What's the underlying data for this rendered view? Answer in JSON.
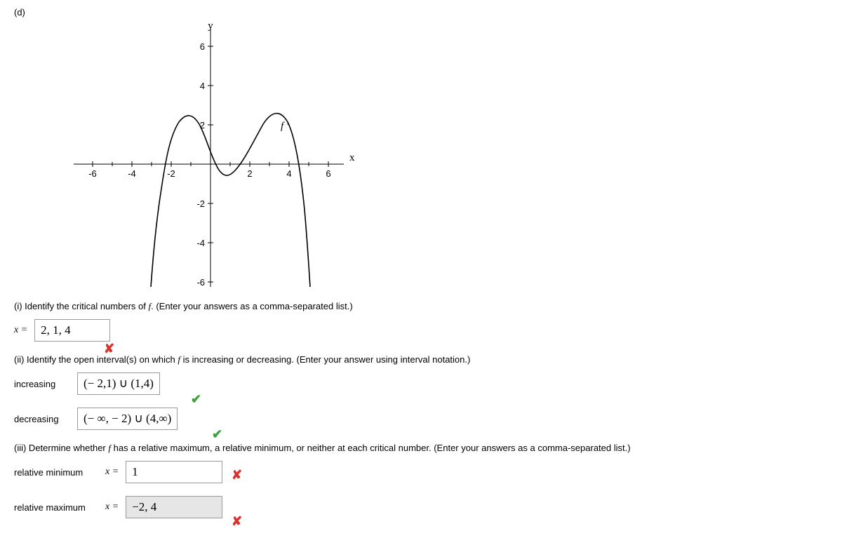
{
  "part_label": "(d)",
  "graph": {
    "y_label": "y",
    "x_label": "x",
    "curve_label": "f '",
    "x_ticks": [
      -6,
      -4,
      -2,
      2,
      4,
      6
    ],
    "y_ticks_pos": [
      2,
      4,
      6
    ],
    "y_ticks_neg": [
      -2,
      -4,
      -6
    ]
  },
  "chart_data": {
    "type": "line",
    "title": "",
    "xlabel": "x",
    "ylabel": "y",
    "xlim": [
      -7,
      7
    ],
    "ylim": [
      -7,
      7
    ],
    "series": [
      {
        "name": "f '",
        "x": [
          -3.1,
          -3,
          -2.8,
          -2.5,
          -2,
          -1.5,
          -1,
          -0.5,
          0,
          0.5,
          1,
          1.5,
          2,
          2.5,
          3,
          3.5,
          4,
          4.3,
          4.6,
          4.9,
          5
        ],
        "y": [
          -7,
          -4.5,
          -2,
          0.6,
          2.3,
          2.5,
          2,
          1.2,
          0.5,
          -0.3,
          -0.6,
          -0.3,
          0.5,
          1.4,
          2.4,
          2.6,
          2.3,
          1,
          -1.5,
          -5,
          -7
        ]
      }
    ]
  },
  "q1": {
    "prompt_pre": "(i) Identify the critical numbers of ",
    "prompt_post": ". (Enter your answers as a comma-separated list.)",
    "x_eq": "x =",
    "answer": "2, 1, 4",
    "correct": false
  },
  "q2": {
    "prompt_pre": "(ii) Identify the open interval(s) on which ",
    "prompt_post": " is increasing or decreasing. (Enter your answer using interval notation.)",
    "rows": [
      {
        "label": "increasing",
        "answer": "(− 2,1) ∪ (1,4)",
        "correct": true
      },
      {
        "label": "decreasing",
        "answer": "(− ∞, − 2) ∪ (4,∞)",
        "correct": true
      }
    ]
  },
  "q3": {
    "prompt_pre": "(iii) Determine whether ",
    "prompt_post": " has a relative maximum, a relative minimum, or neither at each critical number. (Enter your answers as a comma-separated list.)",
    "rows": [
      {
        "label": "relative minimum",
        "x_eq": "x =",
        "answer": "1",
        "correct": false,
        "gray": false
      },
      {
        "label": "relative maximum",
        "x_eq": "x =",
        "answer": "−2, 4",
        "correct": false,
        "gray": true
      }
    ]
  }
}
